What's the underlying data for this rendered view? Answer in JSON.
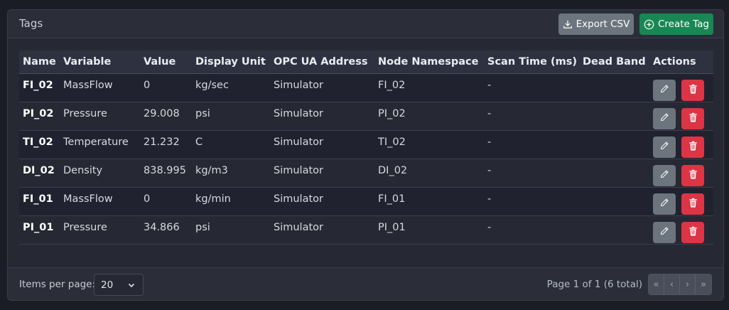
{
  "card": {
    "title": "Tags",
    "export_label": "Export CSV",
    "create_label": "Create Tag",
    "export_icon": "download-icon",
    "create_icon": "plus-circle-icon"
  },
  "table": {
    "columns": [
      "Name",
      "Variable",
      "Value",
      "Display Unit",
      "OPC UA Address",
      "Node Namespace",
      "Scan Time (ms)",
      "Dead Band",
      "Actions"
    ],
    "rows": [
      {
        "name": "FI_02",
        "variable": "MassFlow",
        "value": "0",
        "unit": "kg/sec",
        "address": "Simulator",
        "namespace": "FI_02",
        "scan": "-",
        "deadband": ""
      },
      {
        "name": "PI_02",
        "variable": "Pressure",
        "value": "29.008",
        "unit": "psi",
        "address": "Simulator",
        "namespace": "PI_02",
        "scan": "-",
        "deadband": ""
      },
      {
        "name": "TI_02",
        "variable": "Temperature",
        "value": "21.232",
        "unit": "C",
        "address": "Simulator",
        "namespace": "TI_02",
        "scan": "-",
        "deadband": ""
      },
      {
        "name": "DI_02",
        "variable": "Density",
        "value": "838.995",
        "unit": "kg/m3",
        "address": "Simulator",
        "namespace": "DI_02",
        "scan": "-",
        "deadband": ""
      },
      {
        "name": "FI_01",
        "variable": "MassFlow",
        "value": "0",
        "unit": "kg/min",
        "address": "Simulator",
        "namespace": "FI_01",
        "scan": "-",
        "deadband": ""
      },
      {
        "name": "PI_01",
        "variable": "Pressure",
        "value": "34.866",
        "unit": "psi",
        "address": "Simulator",
        "namespace": "PI_01",
        "scan": "-",
        "deadband": ""
      }
    ],
    "edit_icon": "pencil-icon",
    "delete_icon": "trash-icon"
  },
  "footer": {
    "items_per_page_label": "Items per page:",
    "items_per_page_value": "20",
    "page_info": "Page 1 of 1 (6 total)",
    "pager": [
      "«",
      "‹",
      "›",
      "»"
    ]
  },
  "colors": {
    "background": "#1b1d26",
    "card": "#262833",
    "export_button": "#6c757d",
    "create_button": "#198754",
    "delete_button": "#dc3545",
    "edit_button": "#6c757d"
  }
}
